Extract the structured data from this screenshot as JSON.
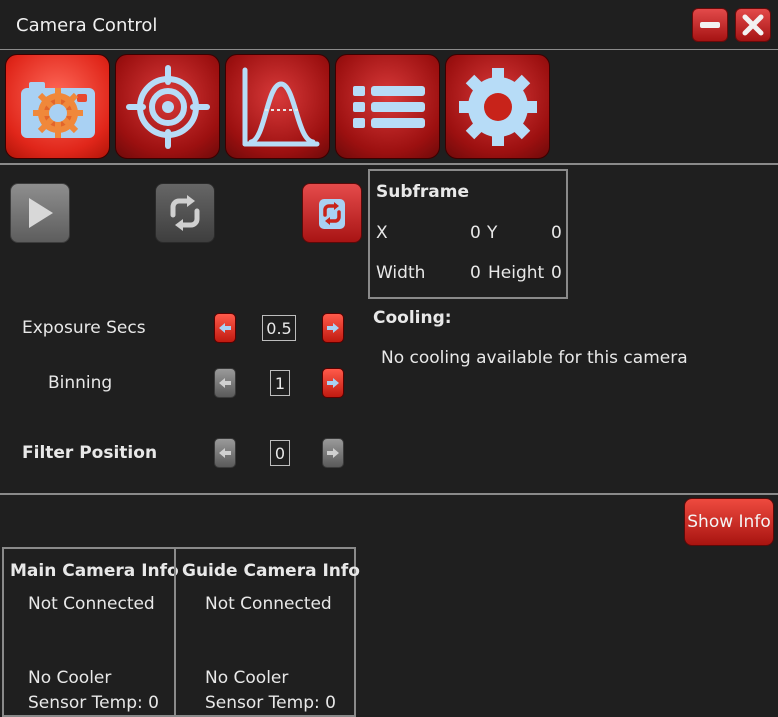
{
  "window": {
    "title": "Camera Control"
  },
  "icons": {
    "minimize": "minimize-icon",
    "close": "close-icon",
    "tabs": [
      "camera-settings-icon",
      "target-icon",
      "histogram-icon",
      "list-icon",
      "gear-icon"
    ],
    "play": "play-icon",
    "loop": "loop-icon",
    "loop_active": "loop-active-icon"
  },
  "colors": {
    "accent": "#d9261a",
    "background": "#1f1f1f",
    "border": "#8a8a8a"
  },
  "subframe": {
    "title": "Subframe",
    "x_label": "X",
    "x_value": "0",
    "y_label": "Y",
    "y_value": "0",
    "width_label": "Width",
    "width_value": "0",
    "height_label": "Height",
    "height_value": "0"
  },
  "cooling": {
    "title": "Cooling:",
    "message": "No cooling available for this camera"
  },
  "exposure": {
    "label": "Exposure Secs",
    "value": "0.5"
  },
  "binning": {
    "label": "Binning",
    "value": "1"
  },
  "filter": {
    "label": "Filter Position",
    "value": "0"
  },
  "show_info": {
    "label": "Show Info"
  },
  "main_camera": {
    "title": "Main Camera Info",
    "status": "Not Connected",
    "cooler": "No Cooler",
    "sensor": "Sensor Temp: 0"
  },
  "guide_camera": {
    "title": "Guide Camera Info",
    "status": "Not Connected",
    "cooler": "No Cooler",
    "sensor": "Sensor Temp: 0"
  }
}
